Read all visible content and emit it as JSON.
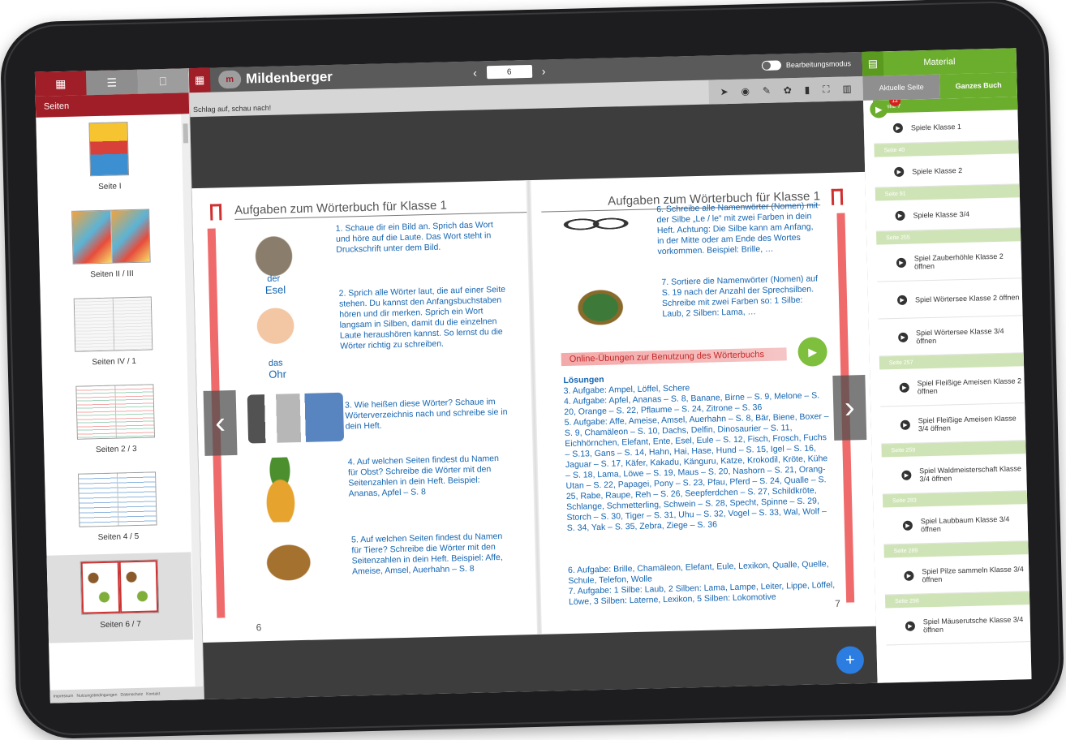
{
  "left_panel": {
    "header": "Seiten",
    "tabs": [
      "pages-grid-icon",
      "outline-icon",
      "bookmark-icon"
    ],
    "thumbnails": [
      {
        "label": "Seite I"
      },
      {
        "label": "Seiten II / III"
      },
      {
        "label": "Seiten IV / 1"
      },
      {
        "label": "Seiten 2 / 3"
      },
      {
        "label": "Seiten 4 / 5"
      },
      {
        "label": "Seiten 6 / 7"
      }
    ],
    "footer": [
      "Impressum",
      "Nutzungsbedingungen",
      "Datenschutz",
      "Kontakt"
    ]
  },
  "topbar": {
    "brand": "Mildenberger",
    "page_input": "6",
    "prev": "‹",
    "next": "›",
    "edit_mode": "Bearbeitungsmodus"
  },
  "toolbar": {
    "breadcrumb": "Schlag auf, schau nach!"
  },
  "book": {
    "left_title": "Aufgaben zum Wörterbuch für Klasse 1",
    "right_title": "Aufgaben zum Wörterbuch für Klasse 1",
    "left_page_num": "6",
    "right_page_num": "7",
    "pic_labels": {
      "esel_art": "der",
      "esel": "Esel",
      "ohr_art": "das",
      "ohr": "Ohr"
    },
    "tasks_left": [
      "1. Schaue dir ein Bild an. Sprich das Wort und höre auf die Laute. Das Wort steht in Druckschrift unter dem Bild.",
      "2. Sprich alle Wörter laut, die auf einer Seite stehen. Du kannst den Anfangsbuchstaben hören und dir merken. Sprich ein Wort langsam in Silben, damit du die einzelnen Laute heraushören kannst. So lernst du die Wörter richtig zu schreiben.",
      "3. Wie heißen diese Wörter? Schaue im Wörterverzeichnis nach und schreibe sie in dein Heft.",
      "4. Auf welchen Seiten findest du Namen für Obst? Schreibe die Wörter mit den Seitenzahlen in dein Heft. Beispiel: Ananas, Apfel – S. 8",
      "5. Auf welchen Seiten findest du Namen für Tiere? Schreibe die Wörter mit den Seitenzahlen in dein Heft. Beispiel: Affe, Ameise, Amsel, Auerhahn – S. 8"
    ],
    "tasks_right": [
      "6. Schreibe alle Namenwörter (Nomen) mit der Silbe „Le / le“ mit zwei Farben in dein Heft. Achtung: Die Silbe kann am Anfang, in der Mitte oder am Ende des Wortes vorkommen. Beispiel: Brille, …",
      "7. Sortiere die Namenwörter (Nomen) auf S. 19 nach der Anzahl der Sprechsilben. Schreibe mit zwei Farben so: 1 Silbe: Laub, 2 Silben: Lama, …"
    ],
    "online_bar": "Online-Übungen zur Benutzung des Wörterbuchs",
    "solutions_title": "Lösungen",
    "solutions": [
      "3. Aufgabe: Ampel, Löffel, Schere",
      "4. Aufgabe: Apfel, Ananas – S. 8, Banane, Birne – S. 9, Melone – S. 20, Orange – S. 22, Pflaume – S. 24, Zitrone – S. 36",
      "5. Aufgabe: Affe, Ameise, Amsel, Auerhahn – S. 8, Bär, Biene, Boxer – S. 9, Chamäleon – S. 10, Dachs, Delfin, Dinosaurier – S. 11, Eichhörnchen, Elefant, Ente, Esel, Eule – S. 12, Fisch, Frosch, Fuchs – S.13, Gans – S. 14, Hahn, Hai, Hase, Hund – S. 15, Igel – S. 16, Jaguar – S. 17, Käfer, Kakadu, Känguru, Katze, Krokodil, Kröte, Kühe – S. 18, Lama, Löwe – S. 19, Maus – S. 20, Nashorn – S. 21, Orang-Utan – S. 22, Papagei, Pony – S. 23, Pfau, Pferd – S. 24, Qualle – S. 25, Rabe, Raupe, Reh – S. 26, Seepferdchen – S. 27, Schildkröte, Schlange, Schmetterling, Schwein – S. 28, Specht, Spinne – S. 29, Storch – S. 30, Tiger – S. 31, Uhu – S. 32, Vogel – S. 33, Wal, Wolf – S. 34, Yak – S. 35, Zebra, Ziege – S. 36",
      "6. Aufgabe: Brille, Chamäleon, Elefant, Eule, Lexikon, Qualle, Quelle, Schule, Telefon, Wolle",
      "7. Aufgabe: 1 Silbe: Laub, 2 Silben: Lama, Lampe, Leiter, Lippe, Löffel, Löwe, 3 Silben: Laterne, Lexikon, 5 Silben: Lokomotive"
    ],
    "fab": "+"
  },
  "right_panel": {
    "title": "Material",
    "tabs": [
      "Aktuelle Seite",
      "Ganzes Buch"
    ],
    "badge": "12",
    "sections": [
      {
        "page": "Seite 7",
        "items": [
          "Spiele Klasse 1"
        ]
      },
      {
        "page": "Seite 40",
        "items": [
          "Spiele Klasse 2"
        ]
      },
      {
        "page": "Seite 91",
        "items": [
          "Spiele Klasse 3/4"
        ]
      },
      {
        "page": "Seite 255",
        "items": [
          "Spiel Zauberhöhle Klasse 2 öffnen",
          "Spiel Wörtersee Klasse 2 öffnen",
          "Spiel Wörtersee Klasse 3/4 öffnen"
        ]
      },
      {
        "page": "Seite 257",
        "items": [
          "Spiel Fleißige Ameisen Klasse 2 öffnen",
          "Spiel Fleißige Ameisen Klasse 3/4 öffnen"
        ]
      },
      {
        "page": "Seite 259",
        "items": [
          "Spiel Waldmeisterschaft Klasse 3/4 öffnen"
        ]
      },
      {
        "page": "Seite 283",
        "items": [
          "Spiel Laubbaum Klasse 3/4 öffnen"
        ]
      },
      {
        "page": "Seite 289",
        "items": [
          "Spiel Pilze sammeln Klasse 3/4 öffnen"
        ]
      },
      {
        "page": "Seite 298",
        "items": [
          "Spiel Mäuserutsche Klasse 3/4 öffnen"
        ]
      }
    ]
  }
}
